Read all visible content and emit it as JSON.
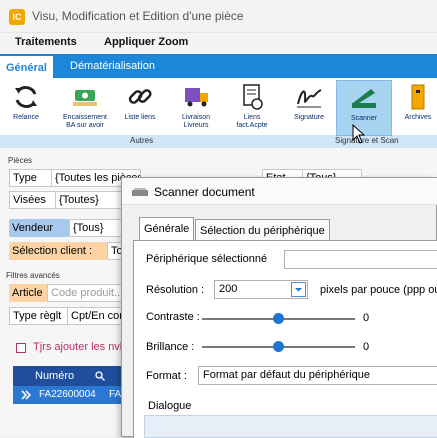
{
  "window": {
    "app_icon_text": "IC",
    "title": "Visu, Modification et Edition d'une pièce"
  },
  "menu": {
    "items": [
      "Traitements",
      "Appliquer Zoom"
    ]
  },
  "ribbon_tabs": [
    "Général",
    "Dématérialisation"
  ],
  "ribbon": {
    "buttons": [
      "Relance",
      "Encaissement BA sur avoir",
      "Liste liens",
      "Livraison Livreurs",
      "Liens fact.Acpte",
      "Signature",
      "Scanner",
      "Archives"
    ],
    "groups": [
      "Autres",
      "Signature et Scan"
    ]
  },
  "form": {
    "section_pieces": "Pièces",
    "type_label": "Type",
    "type_value": "{Toutes les pièces}",
    "visees_label": "Visées",
    "visees_value": "{Toutes}",
    "etat_label": "Etat",
    "etat_value": "{Tous}",
    "vendeur_label": "Vendeur",
    "vendeur_value": "{Tous}",
    "selection_client_label": "Sélection client :",
    "selection_client_value": "To",
    "section_filtres": "Filtres avancés",
    "article_label": "Article",
    "article_placeholder": "Code produit...",
    "type_reglt_label": "Type règlt",
    "type_reglt_value": "Cpt/En cor",
    "checkbox_label": "Tjrs ajouter les nvlle",
    "grid_header_numero": "Numéro",
    "grid_row_numero": "FA22600004",
    "grid_row_col2": "FA"
  },
  "dialog": {
    "title": "Scanner document",
    "tabs": [
      "Générale",
      "Sélection du périphérique"
    ],
    "peripherique_label": "Périphérique sélectionné",
    "peripherique_value": "",
    "resolution_label": "Résolution :",
    "resolution_value": "200",
    "resolution_unit": "pixels par pouce (ppp ou",
    "contraste_label": "Contraste :",
    "contraste_value": "0",
    "contraste_level": 0.5,
    "brillance_label": "Brillance :",
    "brillance_value": "0",
    "brillance_level": 0.5,
    "format_label": "Format :",
    "format_value": "Format par défaut du périphérique",
    "dialogue_label": "Dialogue"
  },
  "colors": {
    "accent": "#1c86d9",
    "selected_row": "#2b78d4",
    "field_highlight": "#fbd3a4",
    "vendeur_bg": "#a9c8ee"
  }
}
